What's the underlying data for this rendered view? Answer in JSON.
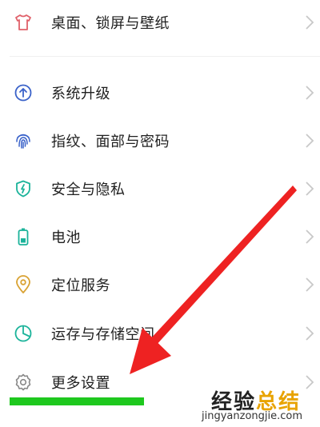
{
  "settings": {
    "items": [
      {
        "label": "桌面、锁屏与壁纸",
        "icon": "tshirt-icon",
        "color": "#e0606a"
      },
      {
        "label": "系统升级",
        "icon": "upgrade-arrow-icon",
        "color": "#3a62c9"
      },
      {
        "label": "指纹、面部与密码",
        "icon": "fingerprint-icon",
        "color": "#3a62c9"
      },
      {
        "label": "安全与隐私",
        "icon": "shield-icon",
        "color": "#1bb39a"
      },
      {
        "label": "电池",
        "icon": "battery-icon",
        "color": "#1bb39a"
      },
      {
        "label": "定位服务",
        "icon": "location-pin-icon",
        "color": "#d9a233"
      },
      {
        "label": "运存与存储空间",
        "icon": "pie-chart-icon",
        "color": "#1bb39a"
      },
      {
        "label": "更多设置",
        "icon": "gear-icon",
        "color": "#888888"
      }
    ]
  },
  "annotation": {
    "arrow_color": "#ee2222",
    "underline_color": "#1ec81e"
  },
  "watermark": {
    "title_part1": "经验",
    "title_part2": "总结",
    "url": "jingyanzongjie.com"
  }
}
